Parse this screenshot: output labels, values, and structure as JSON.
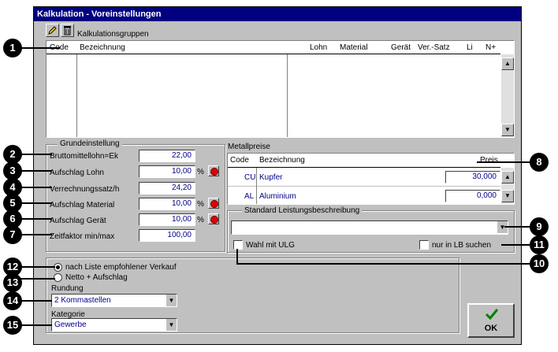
{
  "window": {
    "title": "Kalkulation - Voreinstellungen"
  },
  "toolbar": {
    "label": "Kalkulationsgruppen"
  },
  "groups_table": {
    "columns": [
      "Code",
      "Bezeichnung",
      "Lohn",
      "Material",
      "Gerät",
      "Ver.-Satz",
      "Li",
      "N+"
    ]
  },
  "grundeinstellung": {
    "title": "Grundeinstellung",
    "fields": [
      {
        "label": "Bruttomittellohn=Ek",
        "value": "22,00"
      },
      {
        "label": "Aufschlag Lohn",
        "value": "10,00",
        "unit": "%"
      },
      {
        "label": "Verrechnungssatz/h",
        "value": "24,20"
      },
      {
        "label": "Aufschlag Material",
        "value": "10,00",
        "unit": "%"
      },
      {
        "label": "Aufschlag Gerät",
        "value": "10,00",
        "unit": "%"
      },
      {
        "label": "Zeitfaktor min/max",
        "value": "100,00"
      }
    ]
  },
  "metallpreise": {
    "title": "Metallpreise",
    "columns": [
      "Code",
      "Bezeichnung",
      "Preis"
    ],
    "rows": [
      {
        "code": "CU",
        "name": "Kupfer",
        "price": "30,000"
      },
      {
        "code": "AL",
        "name": "Aluminium",
        "price": "0,000"
      }
    ]
  },
  "standard_lb": {
    "title": "Standard Leistungsbeschreibung",
    "value": "",
    "wahl_ulg": "Wahl mit ULG",
    "nur_lb": "nur in LB suchen"
  },
  "verkauf": {
    "option1": "nach Liste empfohlener Verkauf",
    "option2": "Netto + Aufschlag"
  },
  "rundung": {
    "label": "Rundung",
    "value": "2 Kommastellen"
  },
  "kategorie": {
    "label": "Kategorie",
    "value": "Gewerbe"
  },
  "ok_button": {
    "label": "OK"
  },
  "callouts": [
    "1",
    "2",
    "3",
    "4",
    "5",
    "6",
    "7",
    "8",
    "9",
    "10",
    "11",
    "12",
    "13",
    "14",
    "15"
  ]
}
